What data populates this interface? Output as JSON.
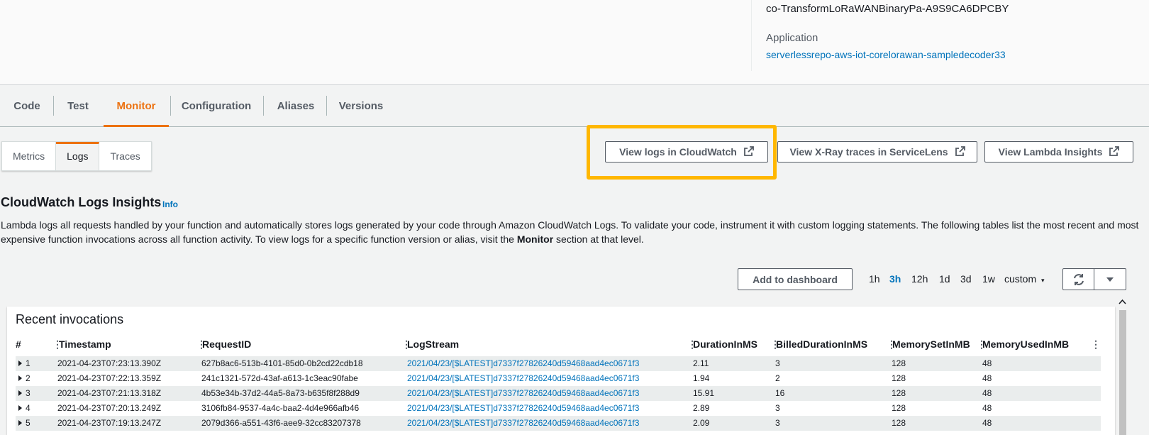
{
  "details": {
    "function_name": "co-TransformLoRaWANBinaryPa-A9S9CA6DPCBY",
    "application_label": "Application",
    "application_link": "serverlessrepo-aws-iot-corelorawan-sampledecoder33"
  },
  "main_tabs": [
    "Code",
    "Test",
    "Monitor",
    "Configuration",
    "Aliases",
    "Versions"
  ],
  "main_tab_active": "Monitor",
  "sub_tabs": [
    "Metrics",
    "Logs",
    "Traces"
  ],
  "sub_tab_active": "Logs",
  "actions": {
    "view_logs": "View logs in CloudWatch",
    "view_xray": "View X-Ray traces in ServiceLens",
    "view_insights": "View Lambda Insights"
  },
  "insights": {
    "title": "CloudWatch Logs Insights",
    "info": "Info",
    "desc_part1": "Lambda logs all requests handled by your function and automatically stores logs generated by your code through Amazon CloudWatch Logs. To validate your code, instrument it with custom logging statements. The following tables list the most recent and most expensive function invocations across all function activity. To view logs for a specific function version or alias, visit the ",
    "desc_bold": "Monitor",
    "desc_part2": " section at that level."
  },
  "toolbar": {
    "add_dashboard": "Add to dashboard",
    "ranges": [
      "1h",
      "3h",
      "12h",
      "1d",
      "3d",
      "1w"
    ],
    "range_active": "3h",
    "custom": "custom"
  },
  "table": {
    "title": "Recent invocations",
    "columns": [
      "#",
      "Timestamp",
      "RequestID",
      "LogStream",
      "DurationInMS",
      "BilledDurationInMS",
      "MemorySetInMB",
      "MemoryUsedInMB"
    ],
    "rows": [
      {
        "n": "1",
        "timestamp": "2021-04-23T07:23:13.390Z",
        "request_id": "627b8ac6-513b-4101-85d0-0b2cd22cdb18",
        "log_stream": "2021/04/23/[$LATEST]d7337f27826240d59468aad4ec0671f3",
        "duration": "2.11",
        "billed": "3",
        "mem_set": "128",
        "mem_used": "48"
      },
      {
        "n": "2",
        "timestamp": "2021-04-23T07:22:13.359Z",
        "request_id": "241c1321-572d-43af-a613-1c3eac90fabe",
        "log_stream": "2021/04/23/[$LATEST]d7337f27826240d59468aad4ec0671f3",
        "duration": "1.94",
        "billed": "2",
        "mem_set": "128",
        "mem_used": "48"
      },
      {
        "n": "3",
        "timestamp": "2021-04-23T07:21:13.318Z",
        "request_id": "4b53e34b-37d2-44a5-8a73-b635f8f288d9",
        "log_stream": "2021/04/23/[$LATEST]d7337f27826240d59468aad4ec0671f3",
        "duration": "15.91",
        "billed": "16",
        "mem_set": "128",
        "mem_used": "48"
      },
      {
        "n": "4",
        "timestamp": "2021-04-23T07:20:13.249Z",
        "request_id": "3106fb84-9537-4a4c-baa2-4d4e966afb46",
        "log_stream": "2021/04/23/[$LATEST]d7337f27826240d59468aad4ec0671f3",
        "duration": "2.89",
        "billed": "3",
        "mem_set": "128",
        "mem_used": "48"
      },
      {
        "n": "5",
        "timestamp": "2021-04-23T07:19:13.247Z",
        "request_id": "2079d366-a551-43f6-aee9-32cc83207378",
        "log_stream": "2021/04/23/[$LATEST]d7337f27826240d59468aad4ec0671f3",
        "duration": "2.09",
        "billed": "3",
        "mem_set": "128",
        "mem_used": "48"
      }
    ]
  }
}
